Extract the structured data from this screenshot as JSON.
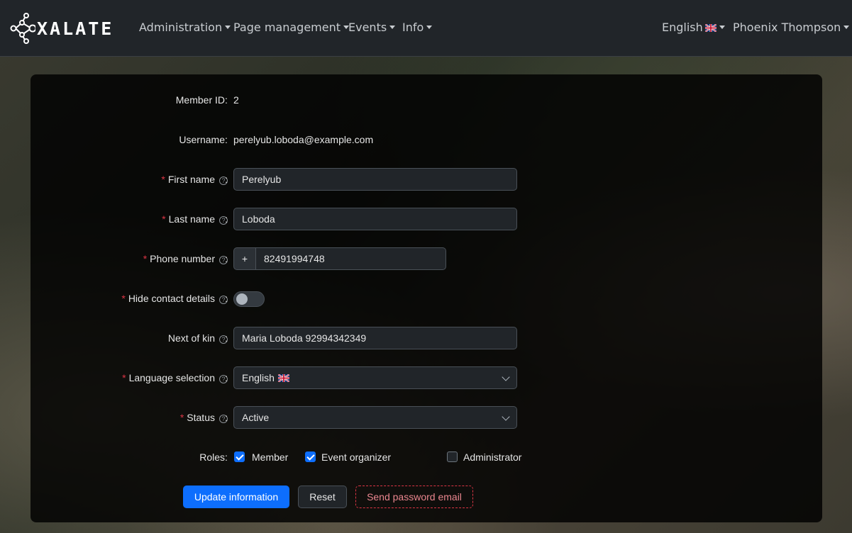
{
  "navbar": {
    "brand": "XALATE",
    "menu": [
      {
        "label": "Administration"
      },
      {
        "label": "Page management"
      },
      {
        "label": "Events"
      },
      {
        "label": "Info"
      }
    ],
    "language": "English",
    "user": "Phoenix Thompson"
  },
  "form": {
    "member_id": {
      "label": "Member ID",
      "value": "2"
    },
    "username": {
      "label": "Username",
      "value": "perelyub.loboda@example.com"
    },
    "first_name": {
      "label": "First name",
      "value": "Perelyub"
    },
    "last_name": {
      "label": "Last name",
      "value": "Loboda"
    },
    "phone": {
      "label": "Phone number",
      "prefix": "+",
      "value": "82491994748"
    },
    "hide_contact": {
      "label": "Hide contact details",
      "checked": false
    },
    "next_of_kin": {
      "label": "Next of kin",
      "value": "Maria Loboda 92994342349"
    },
    "language": {
      "label": "Language selection",
      "value": "English"
    },
    "status": {
      "label": "Status",
      "value": "Active"
    },
    "roles": {
      "label": "Roles",
      "items": [
        {
          "label": "Member",
          "checked": true
        },
        {
          "label": "Event organizer",
          "checked": true
        },
        {
          "label": "Administrator",
          "checked": false
        }
      ]
    },
    "colon": ":",
    "help_glyph": "?",
    "required_mark": "*"
  },
  "buttons": {
    "update": "Update information",
    "reset": "Reset",
    "send_password": "Send password email"
  },
  "colors": {
    "primary": "#0d6efd",
    "danger": "#dc3545",
    "navbar": "#212529"
  }
}
